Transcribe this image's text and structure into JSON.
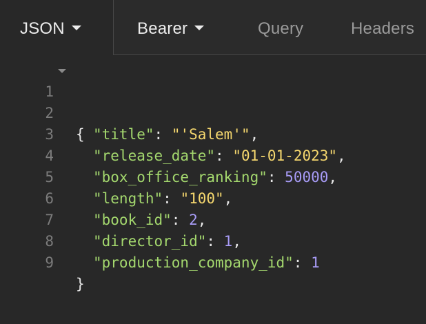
{
  "tabs": {
    "body_type": "JSON",
    "auth_type": "Bearer",
    "query": "Query",
    "headers": "Headers"
  },
  "editor": {
    "line_numbers": [
      "1",
      "2",
      "3",
      "4",
      "5",
      "6",
      "7",
      "8",
      "9"
    ],
    "open_brace": "{",
    "close_brace": "}",
    "fields": [
      {
        "key": "\"title\"",
        "sep": ": ",
        "value": "\"'Salem'\"",
        "type": "string",
        "trail": ","
      },
      {
        "key": "\"release_date\"",
        "sep": ": ",
        "value": "\"01-01-2023\"",
        "type": "string",
        "trail": ","
      },
      {
        "key": "\"box_office_ranking\"",
        "sep": ": ",
        "value": "50000",
        "type": "number",
        "trail": ","
      },
      {
        "key": "\"length\"",
        "sep": ": ",
        "value": "\"100\"",
        "type": "string",
        "trail": ","
      },
      {
        "key": "\"book_id\"",
        "sep": ": ",
        "value": "2",
        "type": "number",
        "trail": ","
      },
      {
        "key": "\"director_id\"",
        "sep": ": ",
        "value": "1",
        "type": "number",
        "trail": ","
      },
      {
        "key": "\"production_company_id\"",
        "sep": ": ",
        "value": "1",
        "type": "number",
        "trail": ""
      }
    ]
  },
  "colors": {
    "background": "#282828",
    "key": "#a4d86e",
    "string": "#f5d76e",
    "number": "#a89cf7",
    "punctuation": "#e8e8e8",
    "line_number": "#7c7c7c"
  }
}
